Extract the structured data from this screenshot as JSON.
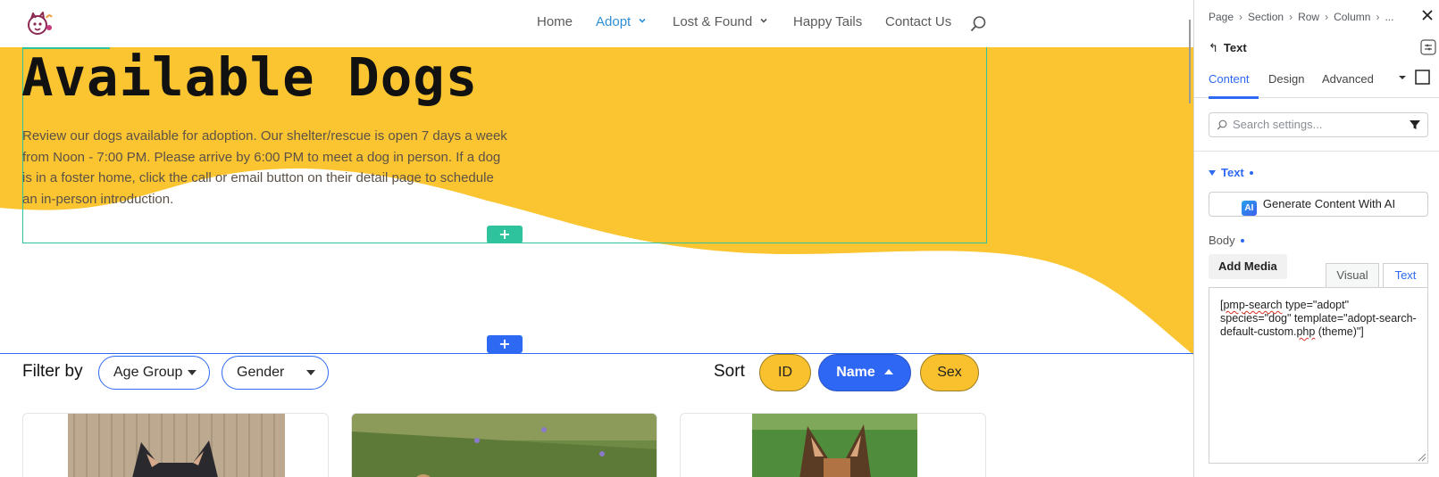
{
  "site": {
    "nav": {
      "home": "Home",
      "adopt": "Adopt",
      "lost_found": "Lost & Found",
      "happy_tails": "Happy Tails",
      "contact": "Contact Us"
    },
    "hero": {
      "title": "Available Dogs",
      "intro": "Review our dogs available for adoption. Our shelter/rescue is open 7 days a week from Noon - 7:00 PM. Please arrive by 6:00 PM to meet a dog in person. If a dog is in a foster home, click the call or email button on their detail page to schedule an in-person introduction."
    },
    "add_glyph": "+",
    "filter": {
      "label": "Filter by",
      "age_group": "Age Group",
      "gender": "Gender"
    },
    "sort": {
      "label": "Sort",
      "id": "ID",
      "name": "Name",
      "sex": "Sex"
    }
  },
  "panel": {
    "breadcrumb": [
      "Page",
      "Section",
      "Row",
      "Column",
      "..."
    ],
    "module_title": "Text",
    "tabs": [
      "Content",
      "Design",
      "Advanced"
    ],
    "search_placeholder": "Search settings...",
    "group_title": "Text",
    "ai_badge": "AI",
    "ai_button": "Generate Content With AI",
    "body_label": "Body",
    "add_media": "Add Media",
    "editor_tabs": {
      "visual": "Visual",
      "text": "Text"
    },
    "shortcode": {
      "p1": "[",
      "p2": "pmp-search",
      "p3": " type=\"adopt\" species=\"dog\" template=\"adopt-search-default-custom.",
      "p4": "php",
      "p5": " (theme)\"]"
    }
  },
  "colors": {
    "hero_yellow": "#fbc531",
    "accent_blue": "#2e69f4",
    "builder_green": "#2fc39d",
    "nav_active": "#2e8fd8"
  },
  "icons": {
    "logo": "pet-logo-icon",
    "search": "search-icon",
    "close": "close-icon",
    "back": "back-arrow-icon",
    "filter": "filter-icon"
  }
}
